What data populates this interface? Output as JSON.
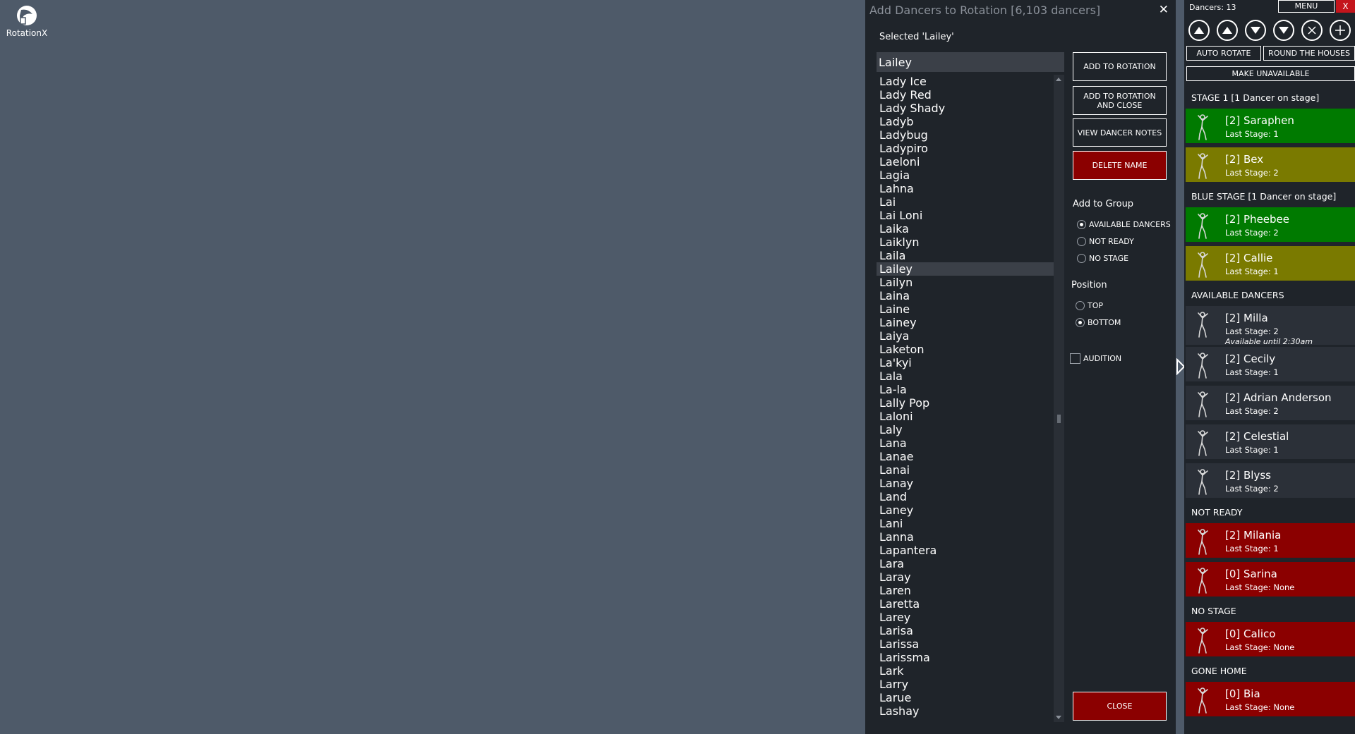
{
  "desktop": {
    "app_icon_label": "RotationX"
  },
  "dialog": {
    "title": "Add Dancers to Rotation [6,103 dancers]",
    "selected_text": "Selected 'Lailey'",
    "search_value": "Lailey",
    "names": [
      "Lady Ice",
      "Lady Red",
      "Lady Shady",
      "Ladyb",
      "Ladybug",
      "Ladypiro",
      "Laeloni",
      "Lagia",
      "Lahna",
      "Lai",
      "Lai Loni",
      "Laika",
      "Laiklyn",
      "Laila",
      "Lailey",
      "Lailyn",
      "Laina",
      "Laine",
      "Lainey",
      "Laiya",
      "Laketon",
      "La'kyi",
      "Lala",
      "La-la",
      "Lally Pop",
      "Laloni",
      "Laly",
      "Lana",
      "Lanae",
      "Lanai",
      "Lanay",
      "Land",
      "Laney",
      "Lani",
      "Lanna",
      "Lapantera",
      "Lara",
      "Laray",
      "Laren",
      "Laretta",
      "Larey",
      "Larisa",
      "Larissa",
      "Larissma",
      "Lark",
      "Larry",
      "Larue",
      "Lashay"
    ],
    "selected_index": 14,
    "buttons": {
      "add": "ADD TO ROTATION",
      "add_close": "ADD TO ROTATION AND CLOSE",
      "notes": "VIEW DANCER NOTES",
      "delete": "DELETE NAME",
      "close": "CLOSE"
    },
    "group_label": "Add to Group",
    "group_options": [
      "AVAILABLE DANCERS",
      "NOT READY",
      "NO STAGE"
    ],
    "group_selected": 0,
    "position_label": "Position",
    "position_options": [
      "TOP",
      "BOTTOM"
    ],
    "position_selected": 1,
    "audition_label": "AUDITION",
    "audition_checked": false
  },
  "panel": {
    "dancers_count": "Dancers: 13",
    "menu_label": "MENU",
    "close_label": "X",
    "auto_rotate": "AUTO ROTATE",
    "round_houses": "ROUND THE HOUSES",
    "make_unavailable": "MAKE UNAVAILABLE",
    "groups": [
      {
        "title": "STAGE  1 [1 Dancer on stage]",
        "dancers": [
          {
            "name": "[2] Saraphen",
            "last": "Last Stage: 1",
            "color": "green"
          },
          {
            "name": "[2] Bex",
            "last": "Last Stage: 2",
            "color": "olive"
          }
        ]
      },
      {
        "title": "BLUE  STAGE [1 Dancer on stage]",
        "dancers": [
          {
            "name": "[2] Pheebee",
            "last": "Last Stage: 2",
            "color": "green"
          },
          {
            "name": "[2] Callie",
            "last": "Last Stage: 1",
            "color": "olive"
          }
        ]
      },
      {
        "title": "AVAILABLE  DANCERS",
        "dancers": [
          {
            "name": "[2] Milla",
            "last": "Last Stage: 2",
            "note": "Available until 2:30am",
            "color": "dark"
          },
          {
            "name": "[2] Cecily",
            "last": "Last Stage: 1",
            "color": "dark"
          },
          {
            "name": "[2] Adrian Anderson",
            "last": "Last Stage: 2",
            "color": "dark"
          },
          {
            "name": "[2] Celestial",
            "last": "Last Stage: 1",
            "color": "dark"
          },
          {
            "name": "[2] Blyss",
            "last": "Last Stage: 2",
            "color": "dark"
          }
        ]
      },
      {
        "title": "NOT READY",
        "dancers": [
          {
            "name": "[2] Milania",
            "last": "Last Stage: 1",
            "color": "red"
          },
          {
            "name": "[0] Sarina",
            "last": "Last Stage: None",
            "color": "red"
          }
        ]
      },
      {
        "title": "NO STAGE",
        "dancers": [
          {
            "name": "[0] Calico",
            "last": "Last Stage: None",
            "color": "red"
          }
        ]
      },
      {
        "title": "GONE HOME",
        "dancers": [
          {
            "name": "[0] Bia",
            "last": "Last Stage: None",
            "color": "red"
          }
        ]
      }
    ]
  },
  "colors": {
    "green": "#007a00",
    "olive": "#7a7a00",
    "dark": "#2b3038",
    "red": "#8b0000",
    "close_x": "#c4151c"
  },
  "icons": [
    "rotationx-logo-icon",
    "close-icon",
    "move-top-icon",
    "move-up-icon",
    "move-down-icon",
    "move-bottom-icon",
    "remove-icon",
    "add-icon",
    "dancer-figure-icon",
    "expand-arrow-icon"
  ]
}
